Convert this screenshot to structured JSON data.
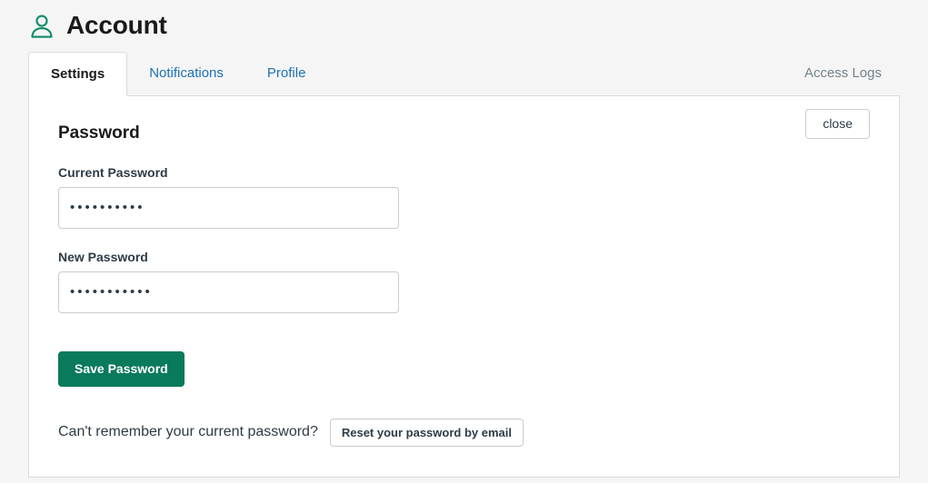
{
  "header": {
    "title": "Account",
    "icon": "user-icon",
    "icon_color": "#0d8a6a"
  },
  "tabs": {
    "items": [
      {
        "label": "Settings",
        "active": true
      },
      {
        "label": "Notifications",
        "active": false
      },
      {
        "label": "Profile",
        "active": false
      }
    ],
    "right_link": "Access Logs"
  },
  "password_section": {
    "title": "Password",
    "close_label": "close",
    "current_password": {
      "label": "Current Password",
      "value": "••••••••••",
      "placeholder": ""
    },
    "new_password": {
      "label": "New Password",
      "value": "•••••••••••",
      "placeholder": ""
    },
    "save_label": "Save Password",
    "reset_prompt": "Can't remember your current password?",
    "reset_label": "Reset your password by email"
  },
  "colors": {
    "accent_green": "#0a7a5c",
    "link_blue": "#1b71b5",
    "page_background": "#f5f5f5",
    "card_background": "#ffffff",
    "border": "#d5dbe0",
    "muted_text": "#73818c"
  }
}
